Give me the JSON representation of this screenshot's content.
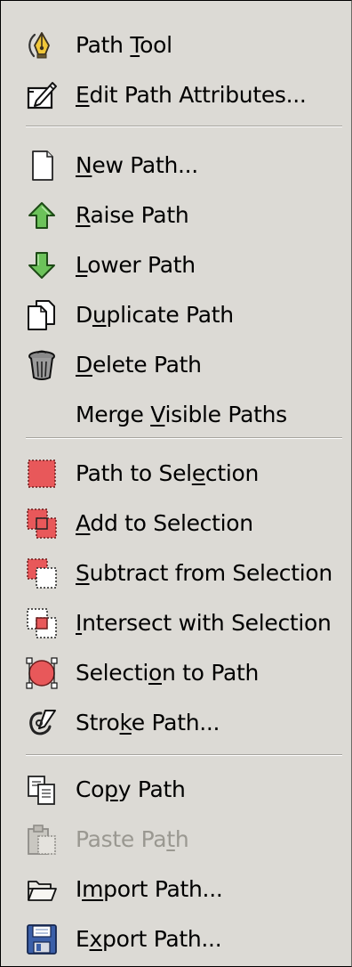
{
  "menu": {
    "items": [
      {
        "label": "Path Tool",
        "mnemonic": 5,
        "icon": "pen-nib-icon",
        "enabled": true
      },
      {
        "label": "Edit Path Attributes...",
        "mnemonic": 0,
        "icon": "edit-attributes-icon",
        "enabled": true
      },
      {
        "label": "New Path...",
        "mnemonic": 0,
        "icon": "new-page-icon",
        "enabled": true
      },
      {
        "label": "Raise Path",
        "mnemonic": 0,
        "icon": "arrow-up-icon",
        "enabled": true
      },
      {
        "label": "Lower Path",
        "mnemonic": 0,
        "icon": "arrow-down-icon",
        "enabled": true
      },
      {
        "label": "Duplicate Path",
        "mnemonic": 1,
        "icon": "duplicate-icon",
        "enabled": true
      },
      {
        "label": "Delete Path",
        "mnemonic": 0,
        "icon": "trash-can-icon",
        "enabled": true
      },
      {
        "label": "Merge Visible Paths",
        "mnemonic": 6,
        "icon": "",
        "enabled": true
      },
      {
        "label": "Path to Selection",
        "mnemonic": 11,
        "icon": "path-to-selection-icon",
        "enabled": true
      },
      {
        "label": "Add to Selection",
        "mnemonic": 0,
        "icon": "selection-add-icon",
        "enabled": true
      },
      {
        "label": "Subtract from Selection",
        "mnemonic": 0,
        "icon": "selection-subtract-icon",
        "enabled": true
      },
      {
        "label": "Intersect with Selection",
        "mnemonic": 0,
        "icon": "selection-intersect-icon",
        "enabled": true
      },
      {
        "label": "Selection to Path",
        "mnemonic": 7,
        "icon": "selection-to-path-icon",
        "enabled": true
      },
      {
        "label": "Stroke Path...",
        "mnemonic": 4,
        "icon": "stroke-path-icon",
        "enabled": true
      },
      {
        "label": "Copy Path",
        "mnemonic": 2,
        "icon": "copy-icon",
        "enabled": true
      },
      {
        "label": "Paste Path",
        "mnemonic": 8,
        "icon": "paste-icon",
        "enabled": false
      },
      {
        "label": "Import Path...",
        "mnemonic": 1,
        "icon": "folder-open-icon",
        "enabled": true
      },
      {
        "label": "Export Path...",
        "mnemonic": 1,
        "icon": "floppy-disk-icon",
        "enabled": true
      }
    ]
  },
  "colors": {
    "menu_background": "#dcdad5",
    "disabled_text": "#9a9891",
    "selection_red": "#e8585a",
    "arrow_green": "#2e8b24",
    "floppy_blue": "#3b5fa8"
  }
}
